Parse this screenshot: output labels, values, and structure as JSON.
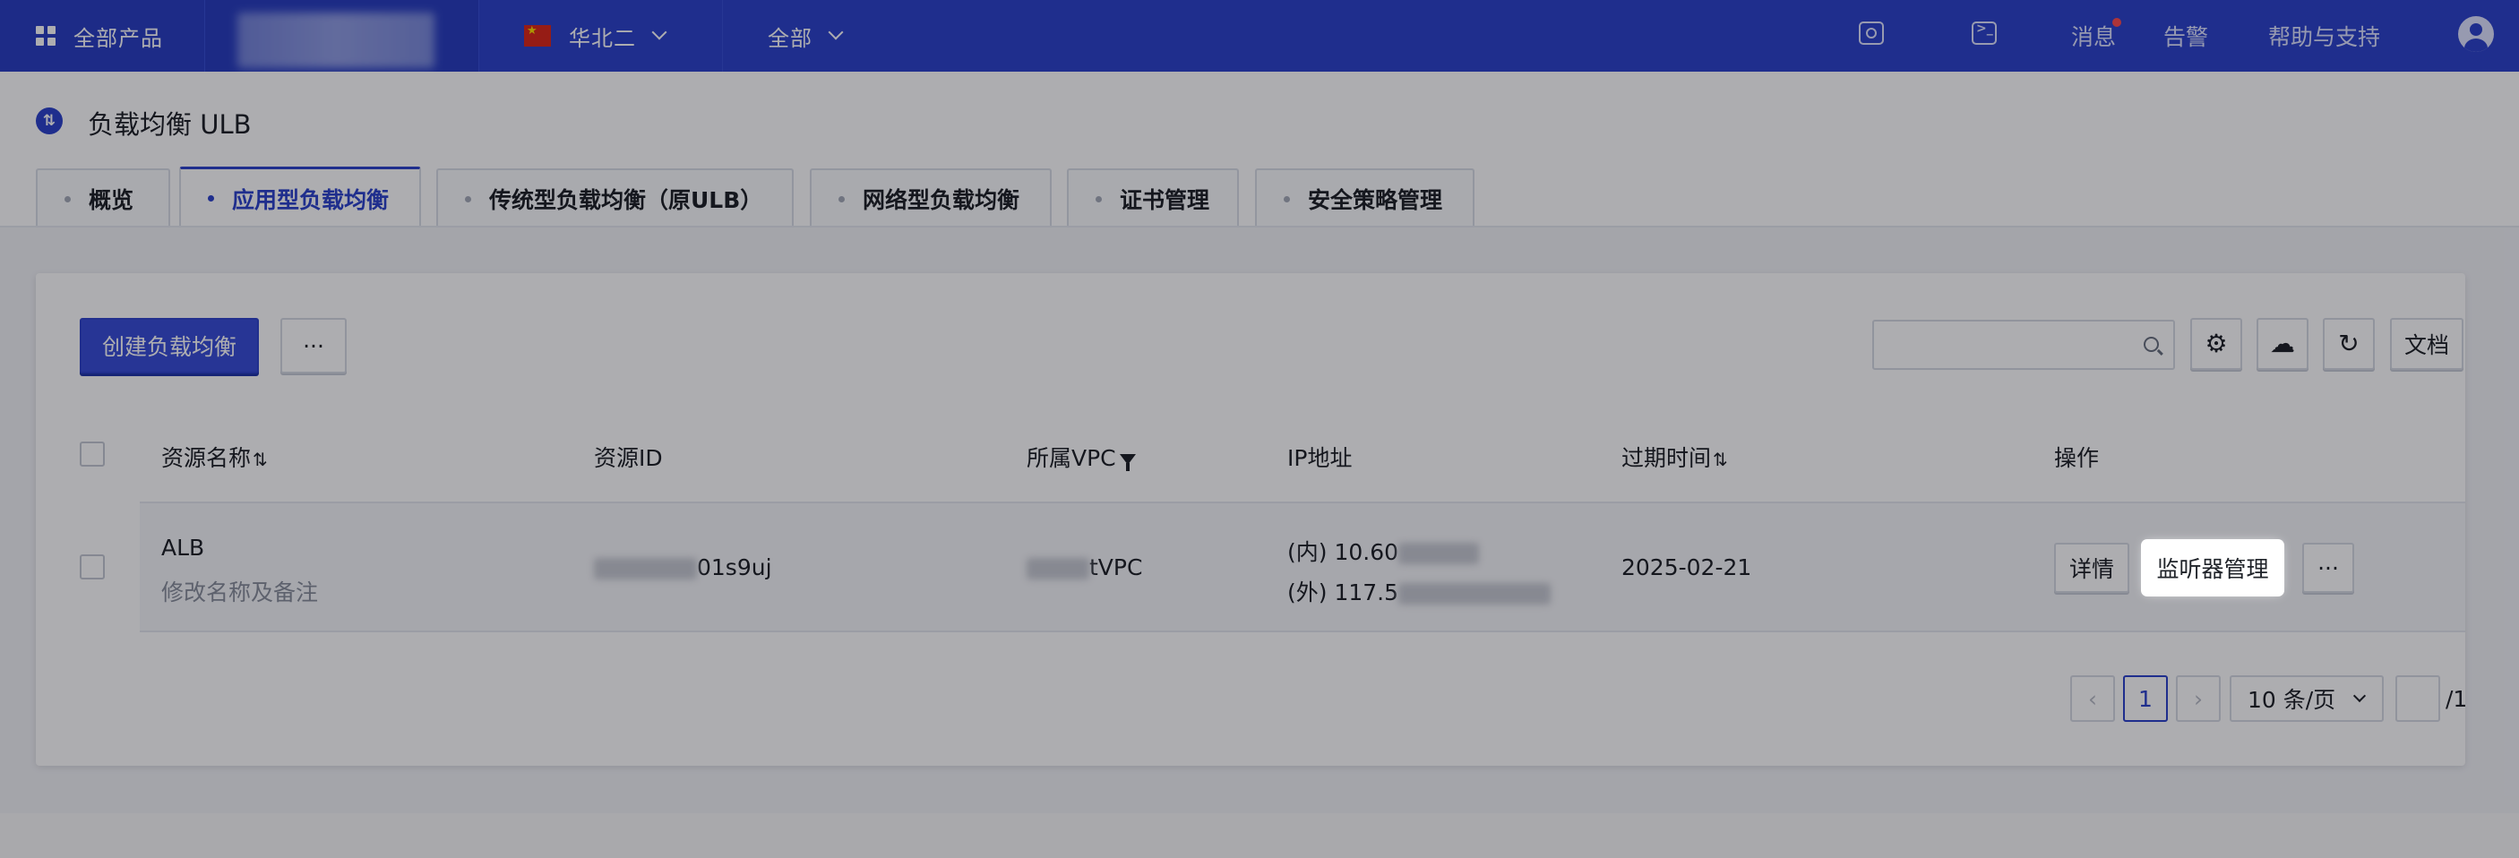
{
  "topbar": {
    "products_label": "全部产品",
    "region_label": "华北二",
    "project_label": "全部",
    "messages_label": "消息",
    "alerts_label": "告警",
    "help_label": "帮助与支持"
  },
  "page": {
    "title": "负载均衡 ULB",
    "title_icon_glyph": "⇅"
  },
  "tabs": [
    {
      "label": "概览"
    },
    {
      "label": "应用型负载均衡",
      "active": true
    },
    {
      "label": "传统型负载均衡（原ULB）"
    },
    {
      "label": "网络型负载均衡"
    },
    {
      "label": "证书管理"
    },
    {
      "label": "安全策略管理"
    }
  ],
  "toolbar": {
    "create_label": "创建负载均衡",
    "more_label": "···",
    "search_placeholder": "",
    "docs_label": "文档",
    "gear_glyph": "⚙",
    "cloud_glyph": "☁",
    "refresh_glyph": "↻"
  },
  "table": {
    "columns": {
      "name": "资源名称",
      "id": "资源ID",
      "vpc": "所属VPC",
      "ip": "IP地址",
      "expire": "过期时间",
      "actions": "操作"
    },
    "sort_glyph": "⇅",
    "rows": [
      {
        "name": "ALB",
        "remark": "修改名称及备注",
        "id_suffix": "01s9uj",
        "vpc_suffix": "tVPC",
        "ip_inner": "(内) 10.60",
        "ip_outer": "(外) 117.5",
        "expire": "2025-02-21",
        "detail_label": "详情",
        "listener_label": "监听器管理",
        "more_label": "···"
      }
    ]
  },
  "pagination": {
    "prev_glyph": "‹",
    "next_glyph": "›",
    "current_page": "1",
    "page_size_label": "10 条/页",
    "total_pages_label": "/1"
  },
  "colors": {
    "brand": "#2e44cc",
    "brand_primary_button": "#3a4fd8",
    "notification_dot": "#ff4d4f"
  }
}
